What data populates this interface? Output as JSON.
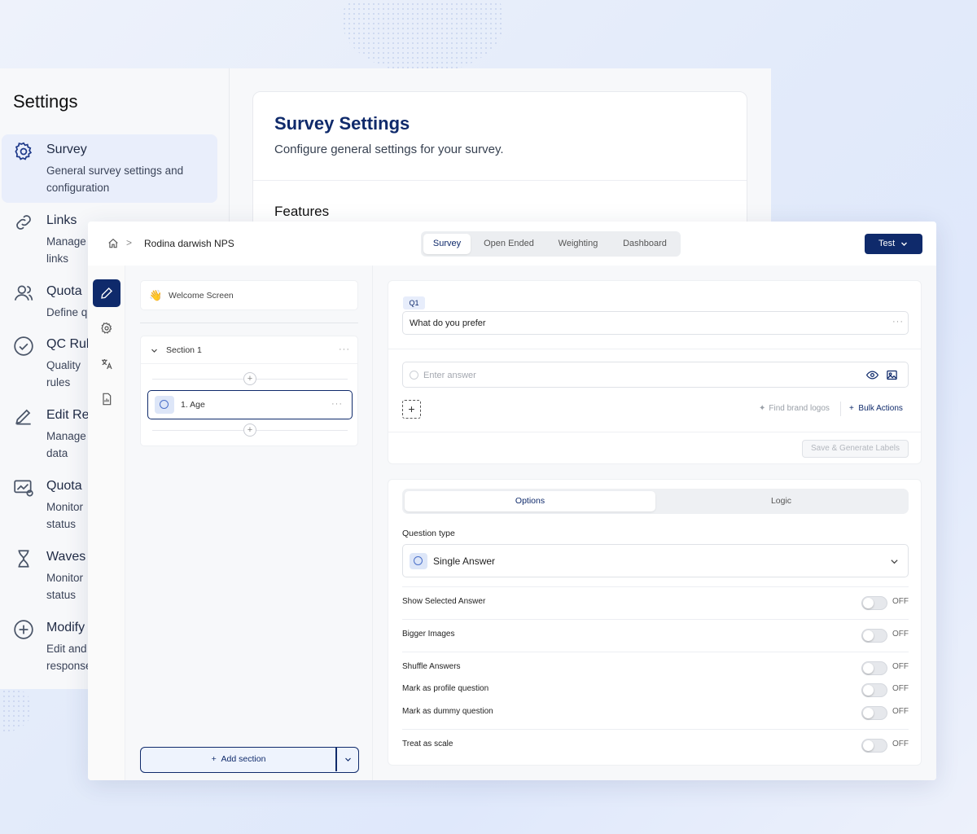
{
  "settings": {
    "title": "Settings",
    "items": [
      {
        "title": "Survey",
        "desc": "General survey settings and configuration",
        "icon": "gear-icon"
      },
      {
        "title": "Links",
        "desc": "Manage links",
        "icon": "link-icon"
      },
      {
        "title": "Quota",
        "desc": "Define q",
        "icon": "users-icon"
      },
      {
        "title": "QC Rul",
        "desc": "Quality rules",
        "icon": "check-circle-icon"
      },
      {
        "title": "Edit Re",
        "desc": "Manage data",
        "icon": "pencil-icon"
      },
      {
        "title": "Quota",
        "desc": "Monitor status",
        "icon": "monitor-icon"
      },
      {
        "title": "Waves",
        "desc": "Monitor status",
        "icon": "hourglass-icon"
      },
      {
        "title": "Modify",
        "desc": "Edit and response",
        "icon": "plus-circle-icon"
      }
    ],
    "card": {
      "heading": "Survey Settings",
      "subheading": "Configure general settings for your survey.",
      "features": "Features"
    }
  },
  "editor": {
    "breadcrumb": {
      "title": "Rodina darwish NPS",
      "separator": ">"
    },
    "tabs": [
      "Survey",
      "Open Ended",
      "Weighting",
      "Dashboard"
    ],
    "active_tab": "Survey",
    "test_button": "Test",
    "welcome": {
      "emoji": "👋",
      "label": "Welcome Screen"
    },
    "section": {
      "label": "Section 1",
      "menu": "···"
    },
    "question_item": {
      "label": "1. Age",
      "menu": "···"
    },
    "add_section": "Add section",
    "question": {
      "badge": "Q1",
      "text": "What do you prefer",
      "menu": "···",
      "answer_placeholder": "Enter answer",
      "add": "+",
      "find_logos": "Find brand logos",
      "bulk_actions": "Bulk Actions",
      "save_generate": "Save & Generate Labels"
    },
    "options": {
      "tabs": [
        "Options",
        "Logic"
      ],
      "active_tab": "Options",
      "question_type_label": "Question type",
      "question_type_value": "Single Answer",
      "toggles": [
        {
          "label": "Show Selected Answer",
          "state": "OFF"
        },
        {
          "label": "Bigger Images",
          "state": "OFF"
        },
        {
          "label": "Shuffle Answers",
          "state": "OFF"
        },
        {
          "label": "Mark as profile question",
          "state": "OFF"
        },
        {
          "label": "Mark as dummy question",
          "state": "OFF"
        },
        {
          "label": "Treat as scale",
          "state": "OFF"
        }
      ]
    }
  },
  "colors": {
    "primary": "#0f2a6b",
    "accent_light": "#e9eefb"
  }
}
